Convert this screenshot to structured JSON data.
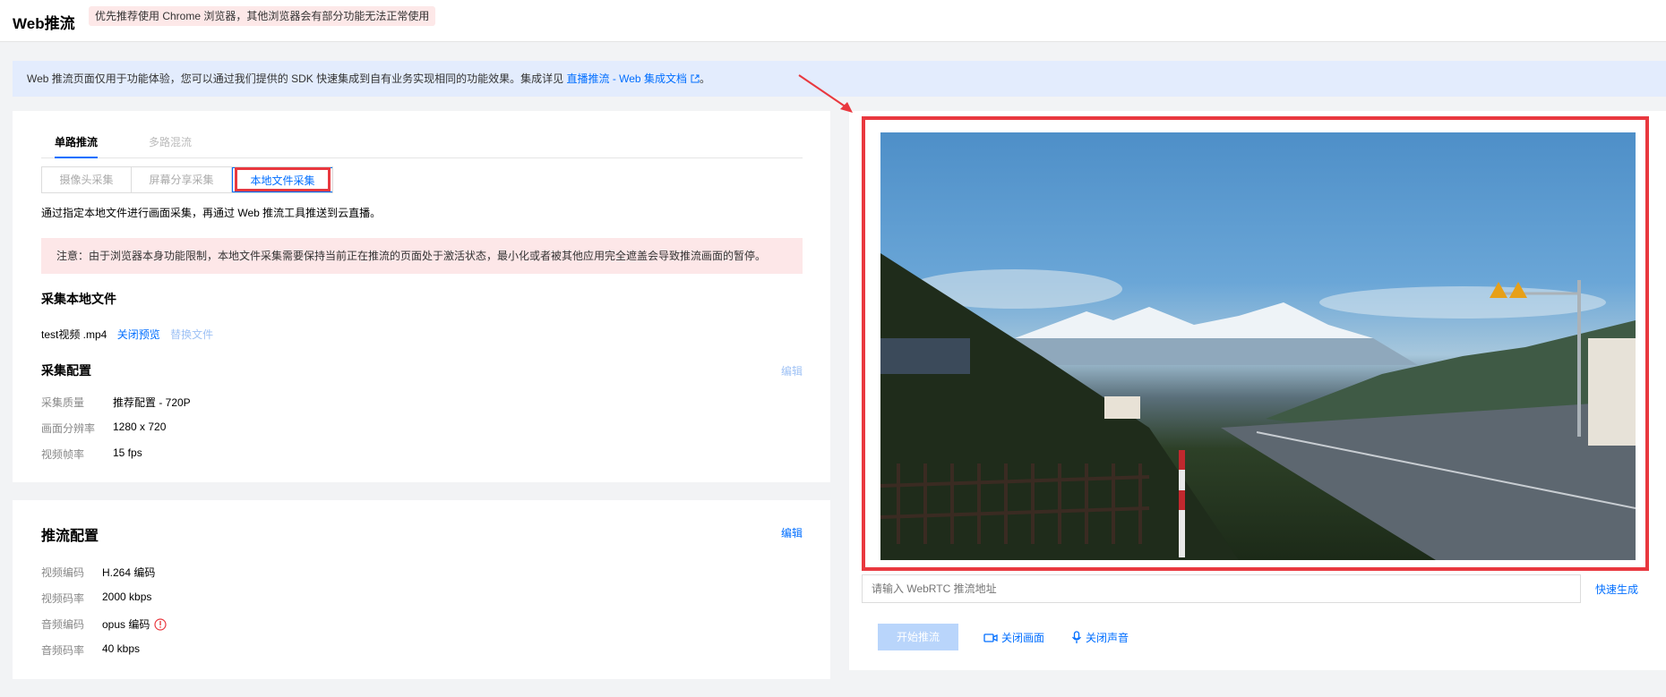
{
  "header": {
    "title": "Web推流",
    "warning": "优先推荐使用 Chrome 浏览器，其他浏览器会有部分功能无法正常使用"
  },
  "notice": {
    "text": "Web 推流页面仅用于功能体验，您可以通过我们提供的 SDK 快速集成到自有业务实现相同的功能效果。集成详见",
    "link": "直播推流 - Web 集成文档",
    "suffix": "。"
  },
  "tabs": [
    {
      "label": "单路推流",
      "active": true
    },
    {
      "label": "多路混流",
      "active": false
    }
  ],
  "capture_modes": [
    {
      "label": "摄像头采集",
      "active": false
    },
    {
      "label": "屏幕分享采集",
      "active": false
    },
    {
      "label": "本地文件采集",
      "active": true
    }
  ],
  "capture": {
    "description": "通过指定本地文件进行画面采集，再通过 Web 推流工具推送到云直播。",
    "alert": "注意：由于浏览器本身功能限制，本地文件采集需要保持当前正在推流的页面处于激活状态，最小化或者被其他应用完全遮盖会导致推流画面的暂停。",
    "file_section_title": "采集本地文件",
    "file_name": "test视频 .mp4",
    "close_preview": "关闭预览",
    "replace_file": "替换文件",
    "config_title": "采集配置",
    "edit_label": "编辑",
    "config": [
      {
        "label": "采集质量",
        "value": "推荐配置 - 720P"
      },
      {
        "label": "画面分辨率",
        "value": "1280 x 720"
      },
      {
        "label": "视频帧率",
        "value": "15 fps"
      }
    ]
  },
  "stream": {
    "title": "推流配置",
    "edit_label": "编辑",
    "config": [
      {
        "label": "视频编码",
        "value": "H.264 编码"
      },
      {
        "label": "视频码率",
        "value": "2000 kbps"
      },
      {
        "label": "音频编码",
        "value": "opus 编码"
      },
      {
        "label": "音频码率",
        "value": "40 kbps"
      }
    ]
  },
  "preview": {
    "url_placeholder": "请输入 WebRTC 推流地址",
    "quick_generate": "快速生成",
    "start_button": "开始推流",
    "close_video": "关闭画面",
    "close_audio": "关闭声音"
  },
  "colors": {
    "accent": "#006eff",
    "highlight_red": "#e9383f",
    "notice_bg": "#e3ecfd",
    "alert_bg": "#fde7e8"
  }
}
